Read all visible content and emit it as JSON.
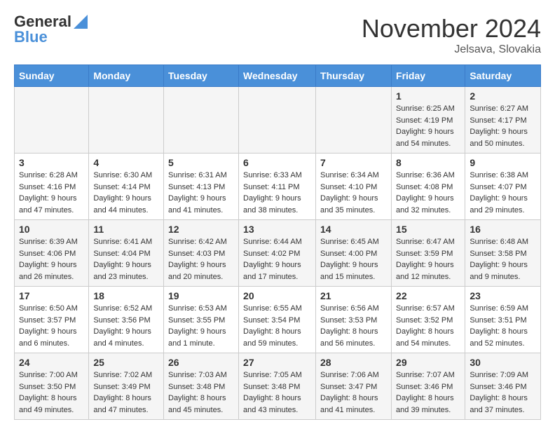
{
  "header": {
    "logo_general": "General",
    "logo_blue": "Blue",
    "month_title": "November 2024",
    "location": "Jelsava, Slovakia"
  },
  "weekdays": [
    "Sunday",
    "Monday",
    "Tuesday",
    "Wednesday",
    "Thursday",
    "Friday",
    "Saturday"
  ],
  "weeks": [
    [
      {
        "day": "",
        "info": ""
      },
      {
        "day": "",
        "info": ""
      },
      {
        "day": "",
        "info": ""
      },
      {
        "day": "",
        "info": ""
      },
      {
        "day": "",
        "info": ""
      },
      {
        "day": "1",
        "info": "Sunrise: 6:25 AM\nSunset: 4:19 PM\nDaylight: 9 hours and 54 minutes."
      },
      {
        "day": "2",
        "info": "Sunrise: 6:27 AM\nSunset: 4:17 PM\nDaylight: 9 hours and 50 minutes."
      }
    ],
    [
      {
        "day": "3",
        "info": "Sunrise: 6:28 AM\nSunset: 4:16 PM\nDaylight: 9 hours and 47 minutes."
      },
      {
        "day": "4",
        "info": "Sunrise: 6:30 AM\nSunset: 4:14 PM\nDaylight: 9 hours and 44 minutes."
      },
      {
        "day": "5",
        "info": "Sunrise: 6:31 AM\nSunset: 4:13 PM\nDaylight: 9 hours and 41 minutes."
      },
      {
        "day": "6",
        "info": "Sunrise: 6:33 AM\nSunset: 4:11 PM\nDaylight: 9 hours and 38 minutes."
      },
      {
        "day": "7",
        "info": "Sunrise: 6:34 AM\nSunset: 4:10 PM\nDaylight: 9 hours and 35 minutes."
      },
      {
        "day": "8",
        "info": "Sunrise: 6:36 AM\nSunset: 4:08 PM\nDaylight: 9 hours and 32 minutes."
      },
      {
        "day": "9",
        "info": "Sunrise: 6:38 AM\nSunset: 4:07 PM\nDaylight: 9 hours and 29 minutes."
      }
    ],
    [
      {
        "day": "10",
        "info": "Sunrise: 6:39 AM\nSunset: 4:06 PM\nDaylight: 9 hours and 26 minutes."
      },
      {
        "day": "11",
        "info": "Sunrise: 6:41 AM\nSunset: 4:04 PM\nDaylight: 9 hours and 23 minutes."
      },
      {
        "day": "12",
        "info": "Sunrise: 6:42 AM\nSunset: 4:03 PM\nDaylight: 9 hours and 20 minutes."
      },
      {
        "day": "13",
        "info": "Sunrise: 6:44 AM\nSunset: 4:02 PM\nDaylight: 9 hours and 17 minutes."
      },
      {
        "day": "14",
        "info": "Sunrise: 6:45 AM\nSunset: 4:00 PM\nDaylight: 9 hours and 15 minutes."
      },
      {
        "day": "15",
        "info": "Sunrise: 6:47 AM\nSunset: 3:59 PM\nDaylight: 9 hours and 12 minutes."
      },
      {
        "day": "16",
        "info": "Sunrise: 6:48 AM\nSunset: 3:58 PM\nDaylight: 9 hours and 9 minutes."
      }
    ],
    [
      {
        "day": "17",
        "info": "Sunrise: 6:50 AM\nSunset: 3:57 PM\nDaylight: 9 hours and 6 minutes."
      },
      {
        "day": "18",
        "info": "Sunrise: 6:52 AM\nSunset: 3:56 PM\nDaylight: 9 hours and 4 minutes."
      },
      {
        "day": "19",
        "info": "Sunrise: 6:53 AM\nSunset: 3:55 PM\nDaylight: 9 hours and 1 minute."
      },
      {
        "day": "20",
        "info": "Sunrise: 6:55 AM\nSunset: 3:54 PM\nDaylight: 8 hours and 59 minutes."
      },
      {
        "day": "21",
        "info": "Sunrise: 6:56 AM\nSunset: 3:53 PM\nDaylight: 8 hours and 56 minutes."
      },
      {
        "day": "22",
        "info": "Sunrise: 6:57 AM\nSunset: 3:52 PM\nDaylight: 8 hours and 54 minutes."
      },
      {
        "day": "23",
        "info": "Sunrise: 6:59 AM\nSunset: 3:51 PM\nDaylight: 8 hours and 52 minutes."
      }
    ],
    [
      {
        "day": "24",
        "info": "Sunrise: 7:00 AM\nSunset: 3:50 PM\nDaylight: 8 hours and 49 minutes."
      },
      {
        "day": "25",
        "info": "Sunrise: 7:02 AM\nSunset: 3:49 PM\nDaylight: 8 hours and 47 minutes."
      },
      {
        "day": "26",
        "info": "Sunrise: 7:03 AM\nSunset: 3:48 PM\nDaylight: 8 hours and 45 minutes."
      },
      {
        "day": "27",
        "info": "Sunrise: 7:05 AM\nSunset: 3:48 PM\nDaylight: 8 hours and 43 minutes."
      },
      {
        "day": "28",
        "info": "Sunrise: 7:06 AM\nSunset: 3:47 PM\nDaylight: 8 hours and 41 minutes."
      },
      {
        "day": "29",
        "info": "Sunrise: 7:07 AM\nSunset: 3:46 PM\nDaylight: 8 hours and 39 minutes."
      },
      {
        "day": "30",
        "info": "Sunrise: 7:09 AM\nSunset: 3:46 PM\nDaylight: 8 hours and 37 minutes."
      }
    ]
  ]
}
